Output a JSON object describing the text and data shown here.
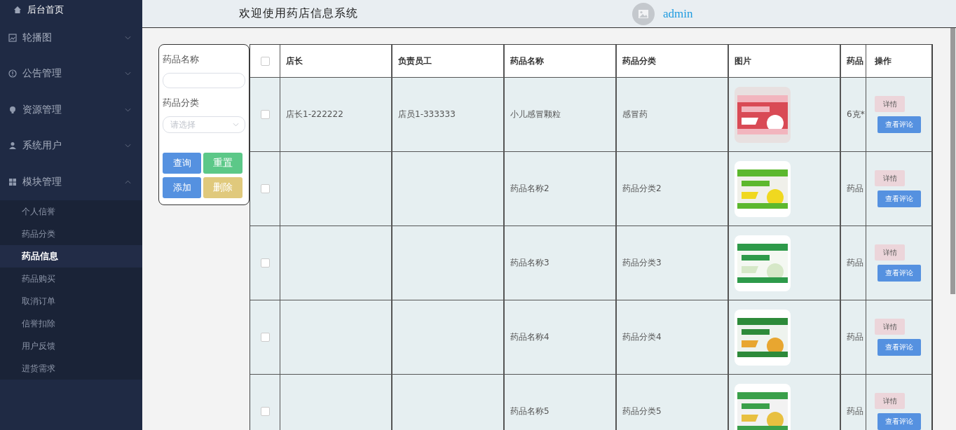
{
  "sidebar": {
    "home": {
      "label": "后台首页"
    },
    "menus": [
      {
        "label": "轮播图",
        "expanded": false
      },
      {
        "label": "公告管理",
        "expanded": false
      },
      {
        "label": "资源管理",
        "expanded": false
      },
      {
        "label": "系统用户",
        "expanded": false
      },
      {
        "label": "模块管理",
        "expanded": true,
        "children": [
          {
            "label": "个人信誉",
            "selected": false
          },
          {
            "label": "药品分类",
            "selected": false
          },
          {
            "label": "药品信息",
            "selected": true
          },
          {
            "label": "药品购买",
            "selected": false
          },
          {
            "label": "取消订单",
            "selected": false
          },
          {
            "label": "信誉扣除",
            "selected": false
          },
          {
            "label": "用户反馈",
            "selected": false
          },
          {
            "label": "进货需求",
            "selected": false
          }
        ]
      }
    ]
  },
  "header": {
    "title": "欢迎使用药店信息系统",
    "user": "admin"
  },
  "filter": {
    "fields": [
      {
        "label": "药品名称",
        "kind": "text"
      },
      {
        "label": "药品分类",
        "kind": "select",
        "placeholder": "请选择"
      }
    ],
    "buttons": [
      {
        "label": "查询",
        "kind": "primary"
      },
      {
        "label": "重置",
        "kind": "success"
      },
      {
        "label": "添加",
        "kind": "primary"
      },
      {
        "label": "删除",
        "kind": "warning"
      }
    ]
  },
  "table": {
    "header_checked": false,
    "columns": [
      "店长",
      "负责员工",
      "药品名称",
      "药品分类",
      "图片",
      "药品"
    ],
    "action_column": "操作",
    "rows": [
      {
        "checked": false,
        "cells": [
          "店长1-222222",
          "店员1-333333",
          "小儿感冒颗粒",
          "感冒药",
          null,
          "6克*"
        ],
        "actions": [
          "详情",
          "查看评论"
        ]
      },
      {
        "checked": false,
        "cells": [
          null,
          null,
          "药品名称2",
          "药品分类2",
          null,
          "药品"
        ],
        "actions": [
          "详情",
          "查看评论"
        ]
      },
      {
        "checked": false,
        "cells": [
          null,
          null,
          "药品名称3",
          "药品分类3",
          null,
          "药品"
        ],
        "actions": [
          "详情",
          "查看评论"
        ]
      },
      {
        "checked": false,
        "cells": [
          null,
          null,
          "药品名称4",
          "药品分类4",
          null,
          "药品"
        ],
        "actions": [
          "详情",
          "查看评论"
        ]
      },
      {
        "checked": false,
        "cells": [
          null,
          null,
          "药品名称5",
          "药品分类5",
          null,
          "药品"
        ],
        "actions": [
          "详情",
          "查看评论"
        ]
      }
    ]
  }
}
